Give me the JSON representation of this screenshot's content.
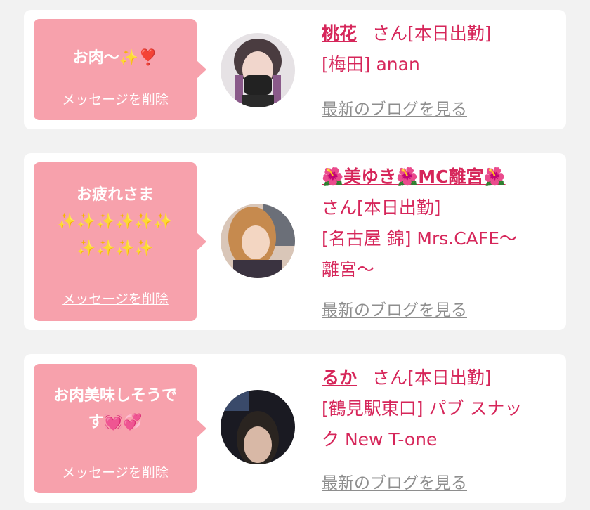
{
  "cards": [
    {
      "message": "お肉〜✨❣️",
      "delete_label": "メッセージを削除",
      "name": "桃花",
      "san_label": "さん[本日出勤]",
      "shop": "[梅田] anan",
      "blog_label": "最新のブログを見る"
    },
    {
      "message_line1": "お疲れさま",
      "message_line2": "✨✨✨✨✨✨",
      "message_line3": "✨✨✨✨",
      "delete_label": "メッセージを削除",
      "name": "🌺美ゆき🌺MC離宮🌺",
      "san_label": "さん[本日出勤]",
      "shop_line1": "[名古屋 錦] Mrs.CAFE〜",
      "shop_line2": "離宮〜",
      "blog_label": "最新のブログを見る"
    },
    {
      "message_line1": "お肉美味しそうで",
      "message_line2": "す💓💞",
      "delete_label": "メッセージを削除",
      "name": "るか",
      "san_label": "さん[本日出勤]",
      "shop_line1": "[鶴見駅東口] パブ スナッ",
      "shop_line2": "ク New T-one",
      "blog_label": "最新のブログを見る"
    }
  ],
  "colors": {
    "accent": "#d6265a",
    "bubble": "#f7a1ac",
    "background": "#f2f2f2",
    "muted": "#8e8e8e"
  }
}
